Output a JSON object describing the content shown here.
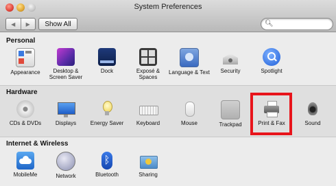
{
  "window": {
    "title": "System Preferences"
  },
  "toolbar": {
    "back_label": "◀",
    "forward_label": "▶",
    "show_all_label": "Show All",
    "search_value": "",
    "search_placeholder": ""
  },
  "sections": [
    {
      "title": "Personal",
      "items": [
        {
          "label": "Appearance",
          "icon": "appearance-icon"
        },
        {
          "label": "Desktop & Screen Saver",
          "icon": "desktop-icon"
        },
        {
          "label": "Dock",
          "icon": "dock-icon"
        },
        {
          "label": "Exposé & Spaces",
          "icon": "expose-icon"
        },
        {
          "label": "Language & Text",
          "icon": "language-icon"
        },
        {
          "label": "Security",
          "icon": "security-icon"
        },
        {
          "label": "Spotlight",
          "icon": "spotlight-icon"
        }
      ]
    },
    {
      "title": "Hardware",
      "items": [
        {
          "label": "CDs & DVDs",
          "icon": "cd-icon"
        },
        {
          "label": "Displays",
          "icon": "display-icon"
        },
        {
          "label": "Energy Saver",
          "icon": "energy-icon"
        },
        {
          "label": "Keyboard",
          "icon": "keyboard-icon"
        },
        {
          "label": "Mouse",
          "icon": "mouse-icon"
        },
        {
          "label": "Trackpad",
          "icon": "trackpad-icon"
        },
        {
          "label": "Print & Fax",
          "icon": "printer-icon"
        },
        {
          "label": "Sound",
          "icon": "speaker-icon"
        }
      ]
    },
    {
      "title": "Internet & Wireless",
      "items": [
        {
          "label": "MobileMe",
          "icon": "cloud-icon"
        },
        {
          "label": "Network",
          "icon": "network-icon"
        },
        {
          "label": "Bluetooth",
          "icon": "bluetooth-icon"
        },
        {
          "label": "Sharing",
          "icon": "sharing-icon"
        }
      ]
    }
  ],
  "colors": {
    "highlight": "#e8141b",
    "accent_blue": "#2a6ad8"
  }
}
